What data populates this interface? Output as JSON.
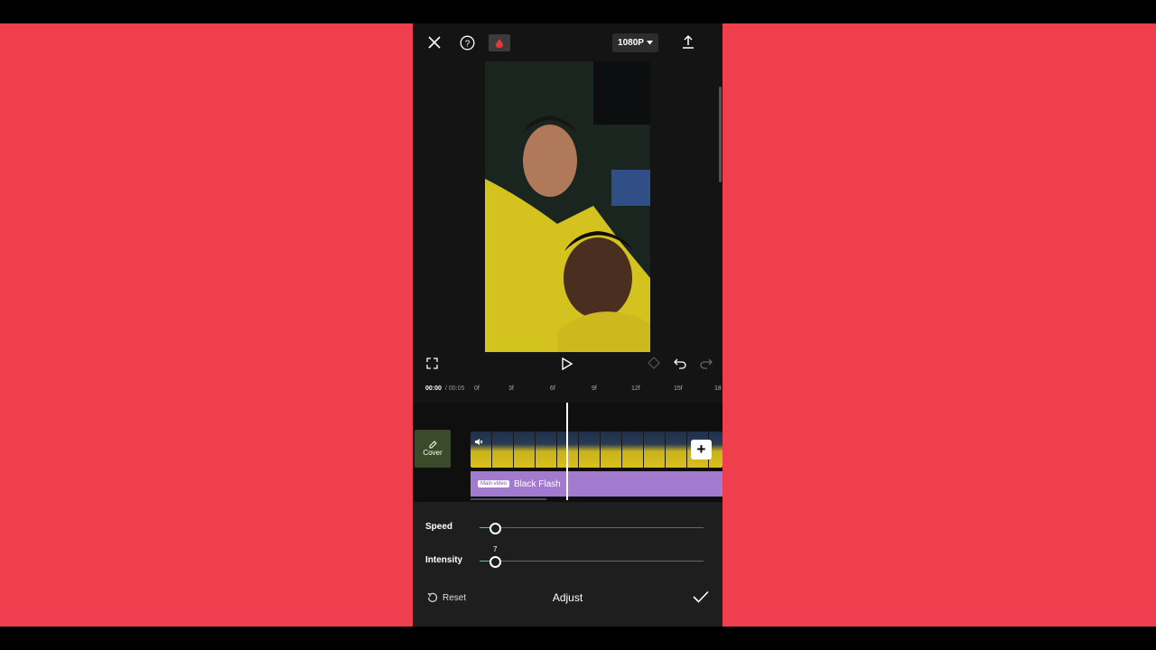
{
  "topbar": {
    "close_icon": "close-icon",
    "help_icon": "help-icon",
    "record_icon": "record-icon",
    "resolution_label": "1080P",
    "export_icon": "export-icon"
  },
  "playback": {
    "fullscreen_icon": "fullscreen-icon",
    "play_icon": "play-icon",
    "keyframe_icon": "keyframe-icon",
    "undo_icon": "undo-icon",
    "redo_icon": "redo-icon"
  },
  "timeline": {
    "current_time": "00:00",
    "total_time": "/ 00:05",
    "ruler_ticks": [
      "0f",
      "3f",
      "6f",
      "9f",
      "12f",
      "15f",
      "18"
    ],
    "cover_label": "Cover",
    "add_icon": "plus-icon",
    "effect_badge": "Main video",
    "effect_label": "Black Flash"
  },
  "adjust_panel": {
    "speed_label": "Speed",
    "speed_value": 0.07,
    "intensity_label": "Intensity",
    "intensity_value_label": "7",
    "intensity_value": 0.07,
    "reset_label": "Reset",
    "title": "Adjust",
    "confirm_icon": "check-icon"
  },
  "colors": {
    "side_background": "#ef3f4f",
    "app_background": "#141414",
    "effect_track": "#a27bd0",
    "slider_accent": "#3ec9c9"
  }
}
